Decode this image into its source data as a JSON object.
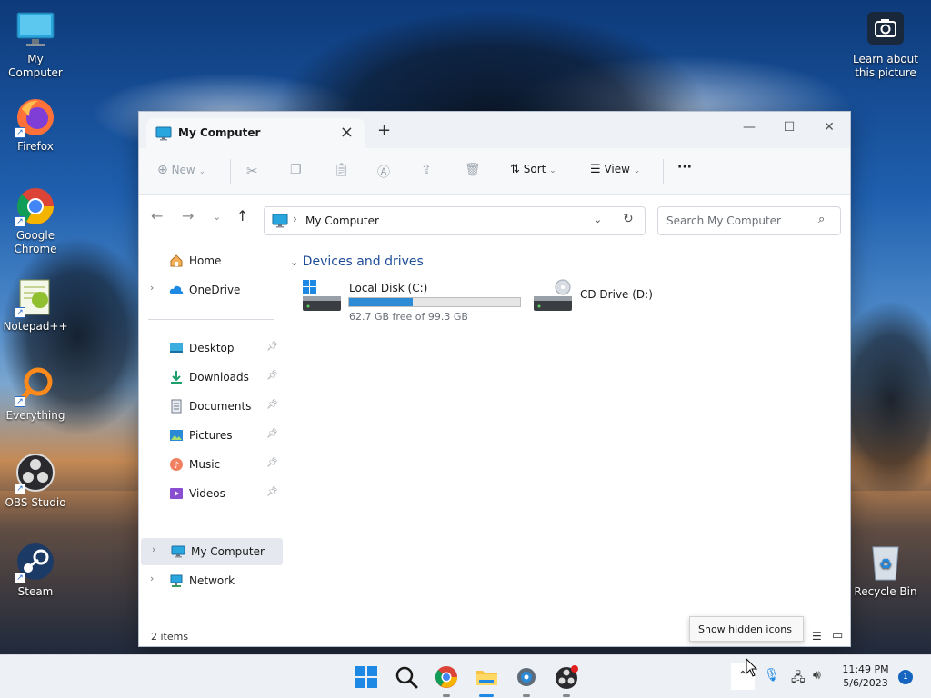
{
  "desktop": {
    "icons": [
      {
        "label": "My Computer"
      },
      {
        "label": "Firefox"
      },
      {
        "label": "Google Chrome"
      },
      {
        "label": "Notepad++"
      },
      {
        "label": "Everything"
      },
      {
        "label": "OBS Studio"
      },
      {
        "label": "Steam"
      }
    ],
    "learn_picture": "Learn about this picture",
    "recycle_bin": "Recycle Bin"
  },
  "window": {
    "tab_title": "My Computer",
    "toolbar": {
      "new_label": "New",
      "sort_label": "Sort",
      "view_label": "View",
      "more_label": "···"
    },
    "address": {
      "path": "My Computer",
      "search_placeholder": "Search My Computer"
    },
    "sidebar": {
      "home": "Home",
      "onedrive": "OneDrive",
      "quick": [
        {
          "label": "Desktop"
        },
        {
          "label": "Downloads"
        },
        {
          "label": "Documents"
        },
        {
          "label": "Pictures"
        },
        {
          "label": "Music"
        },
        {
          "label": "Videos"
        }
      ],
      "my_computer": "My Computer",
      "network": "Network"
    },
    "content": {
      "group_title": "Devices and drives",
      "drives": [
        {
          "name": "Local Disk (C:)",
          "free_text": "62.7 GB free of 99.3 GB",
          "used_fraction": 0.37
        },
        {
          "name": "CD Drive (D:)"
        }
      ]
    },
    "status": "2 items"
  },
  "tooltip": "Show hidden icons",
  "taskbar": {
    "time": "11:49 PM",
    "date": "5/6/2023",
    "notification_count": "1"
  }
}
